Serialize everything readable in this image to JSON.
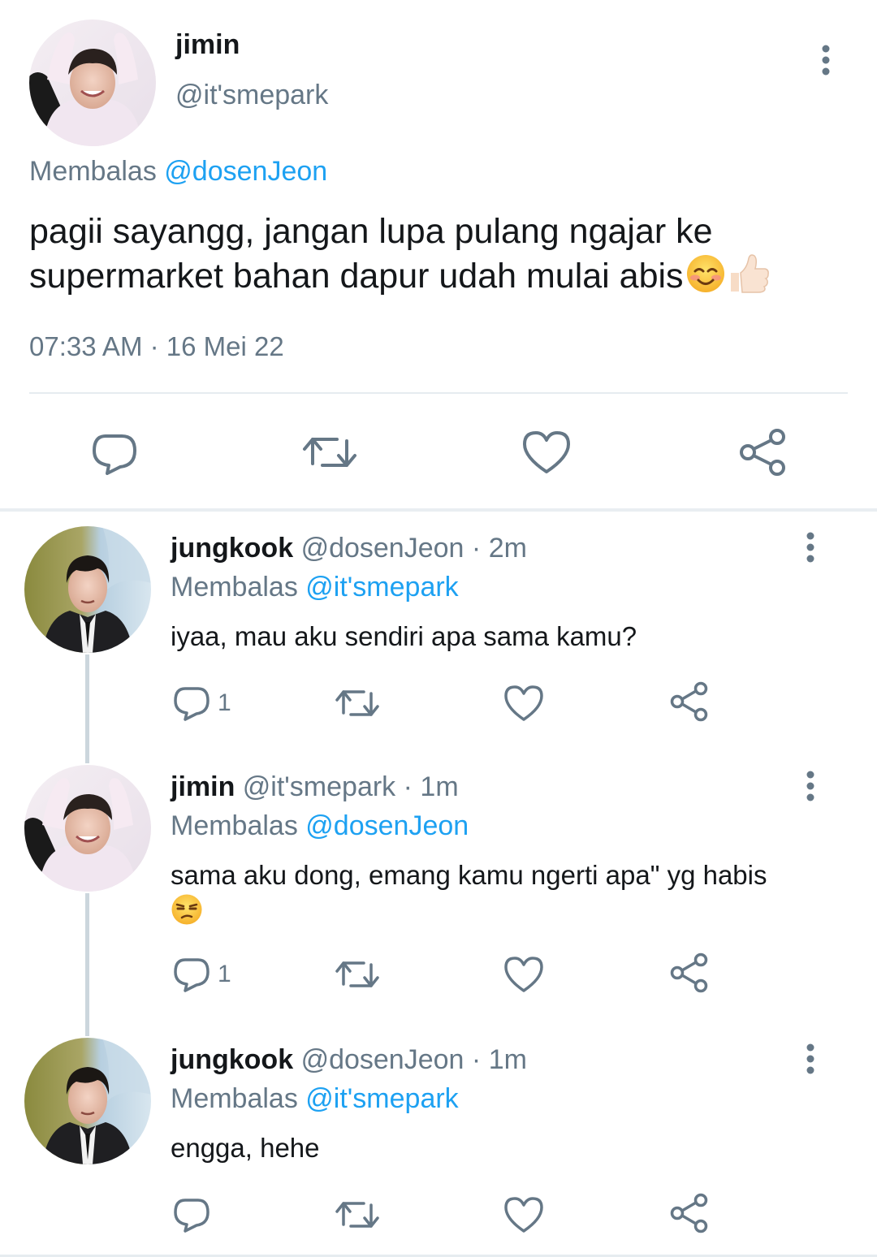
{
  "main_tweet": {
    "name": "jimin",
    "handle": "@it'smepark",
    "replying_prefix": "Membalas",
    "replying_to": "@dosenJeon",
    "text": "pagii sayangg, jangan lupa pulang ngajar ke supermarket bahan dapur udah mulai abis",
    "emojis": [
      "relieved-smile-emoji",
      "thumbs-up-emoji"
    ],
    "time": "07:33 AM",
    "separator": "·",
    "date": "16 Mei 22",
    "actions": [
      "reply",
      "retweet",
      "like",
      "share"
    ]
  },
  "replies": [
    {
      "name": "jungkook",
      "handle": "@dosenJeon",
      "separator": "·",
      "time": "2m",
      "replying_prefix": "Membalas",
      "replying_to": "@it'smepark",
      "text": "iyaa, mau aku sendiri apa sama kamu?",
      "reply_count": "1"
    },
    {
      "name": "jimin",
      "handle": "@it'smepark",
      "separator": "·",
      "time": "1m",
      "replying_prefix": "Membalas",
      "replying_to": "@dosenJeon",
      "text": "sama aku dong, emang kamu ngerti apa\" yg habis",
      "emoji": "unamused-face-emoji",
      "reply_count": "1"
    },
    {
      "name": "jungkook",
      "handle": "@dosenJeon",
      "separator": "·",
      "time": "1m",
      "replying_prefix": "Membalas",
      "replying_to": "@it'smepark",
      "text": "engga, hehe",
      "reply_count": ""
    }
  ],
  "colors": {
    "text": "#14171a",
    "muted": "#657786",
    "mention": "#1da1f2",
    "icon": "#657786",
    "divider": "#e6ecf0",
    "thread_line": "#ccd6dd"
  }
}
